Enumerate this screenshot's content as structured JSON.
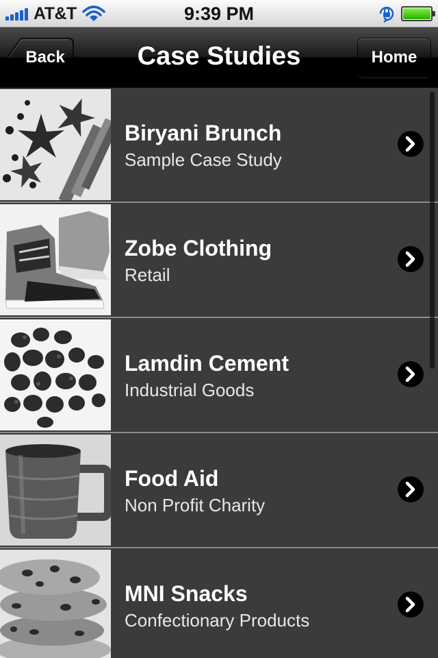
{
  "status_bar": {
    "carrier": "AT&T",
    "time": "9:39 PM",
    "icons": [
      "signal-icon",
      "wifi-icon",
      "rotation-lock-icon",
      "battery-icon"
    ]
  },
  "nav": {
    "title": "Case Studies",
    "back_label": "Back",
    "home_label": "Home"
  },
  "rows": [
    {
      "title": "Biryani Brunch",
      "subtitle": "Sample Case Study",
      "image": "spices-image"
    },
    {
      "title": "Zobe Clothing",
      "subtitle": "Retail",
      "image": "sneakers-image"
    },
    {
      "title": "Lamdin Cement",
      "subtitle": "Industrial Goods",
      "image": "rocks-image"
    },
    {
      "title": "Food Aid",
      "subtitle": "Non Profit Charity",
      "image": "mug-image"
    },
    {
      "title": "MNI Snacks",
      "subtitle": "Confectionary Products",
      "image": "cookies-image"
    }
  ],
  "colors": {
    "list_background": "#3b3b3b",
    "separator": "#8c8c8c",
    "nav_bar": "#000000",
    "battery": "#22b000",
    "signal": "#1b61c9"
  }
}
